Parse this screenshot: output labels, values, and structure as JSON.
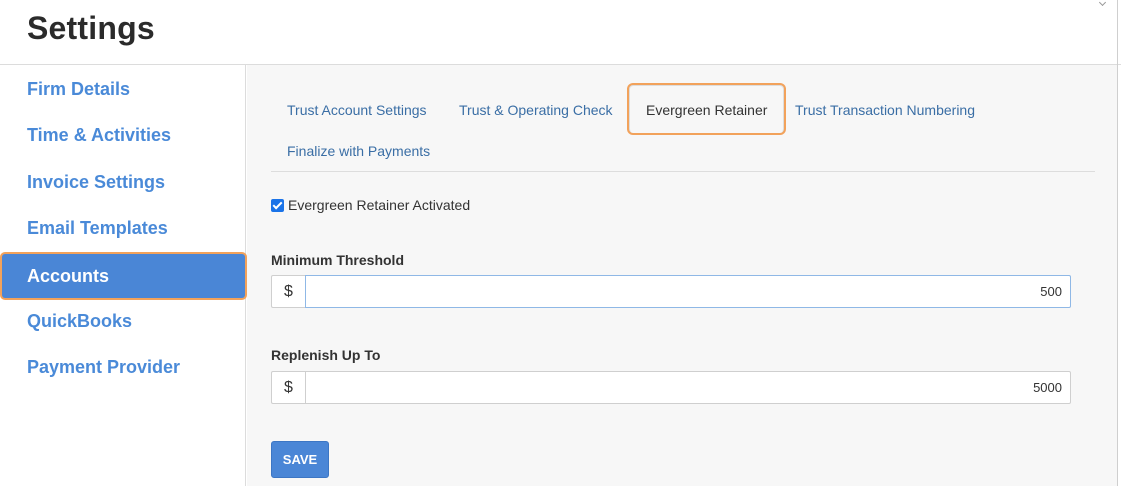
{
  "page": {
    "title": "Settings"
  },
  "sidebar": {
    "items": [
      {
        "label": "Firm Details"
      },
      {
        "label": "Time & Activities"
      },
      {
        "label": "Invoice Settings"
      },
      {
        "label": "Email Templates"
      },
      {
        "label": "Accounts",
        "active": true
      },
      {
        "label": "QuickBooks"
      },
      {
        "label": "Payment Provider"
      }
    ]
  },
  "tabs": [
    {
      "label": "Trust Account Settings"
    },
    {
      "label": "Trust & Operating Check"
    },
    {
      "label": "Evergreen Retainer",
      "active": true
    },
    {
      "label": "Trust Transaction Numbering"
    },
    {
      "label": "Finalize with Payments"
    }
  ],
  "form": {
    "activated": {
      "label": "Evergreen Retainer Activated",
      "checked": true
    },
    "minimum_threshold": {
      "label": "Minimum Threshold",
      "prefix": "$",
      "value": "500"
    },
    "replenish_up_to": {
      "label": "Replenish Up To",
      "prefix": "$",
      "value": "5000"
    },
    "save_label": "SAVE"
  },
  "colors": {
    "accent": "#4a86d6",
    "link": "#3a6ea5",
    "highlight": "#f2a25b"
  }
}
